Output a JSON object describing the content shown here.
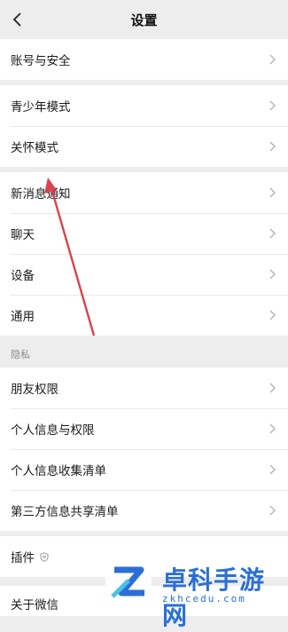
{
  "header": {
    "title": "设置",
    "back_icon": "chevron-left-icon"
  },
  "groups": {
    "account": [
      "账号与安全"
    ],
    "mode": [
      "青少年模式",
      "关怀模式"
    ],
    "general": [
      "新消息通知",
      "聊天",
      "设备",
      "通用"
    ],
    "privacy_label": "隐私",
    "privacy": [
      "朋友权限",
      "个人信息与权限",
      "个人信息收集清单",
      "第三方信息共享清单"
    ],
    "plugins": "插件",
    "about": "关于微信"
  },
  "watermark": {
    "name": "卓科手游网",
    "url": "zkhcedu.com"
  },
  "colors": {
    "background": "#ededed",
    "card": "#ffffff",
    "accent": "#2b6fd6",
    "arrow": "#d9434f"
  }
}
